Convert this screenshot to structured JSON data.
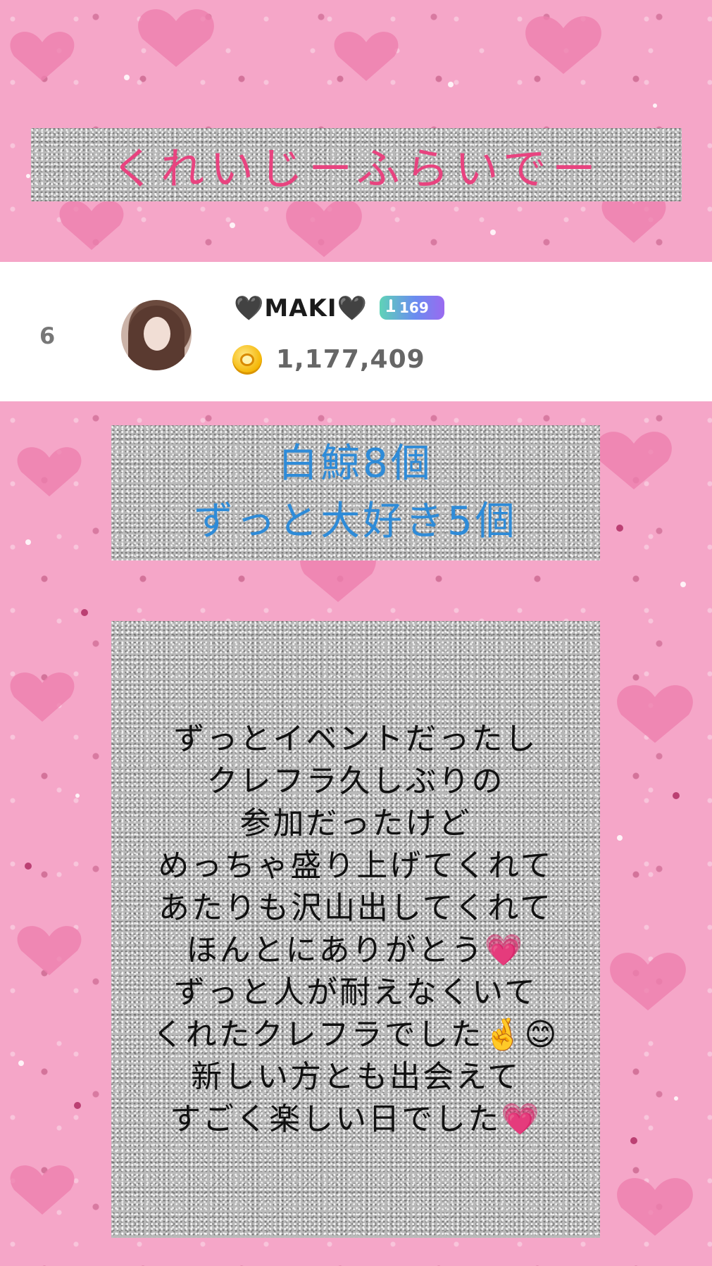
{
  "banner": {
    "title": "くれいじーふらいでー"
  },
  "ranking_entry": {
    "rank": "6",
    "username": "🖤MAKI🖤",
    "level_badge": "169",
    "points": "1,177,409"
  },
  "gifts": {
    "line1": "白鯨8個",
    "line2": "ずっと大好き5個"
  },
  "message": {
    "lines": [
      "ずっとイベントだったし",
      "クレフラ久しぶりの",
      "参加だったけど",
      "めっちゃ盛り上げてくれて",
      "あたりも沢山出してくれて",
      "ほんとにありがとう💗",
      "ずっと人が耐えなくいて",
      "くれたクレフラでした🤞😊",
      "新しい方とも出会えて",
      "すごく楽しい日でした💗"
    ]
  },
  "colors": {
    "title_pink": "#e8437f",
    "gift_blue": "#2e8bd8",
    "bg_pink": "#f5a6c8",
    "glitter_gray": "#b9b9b9"
  }
}
